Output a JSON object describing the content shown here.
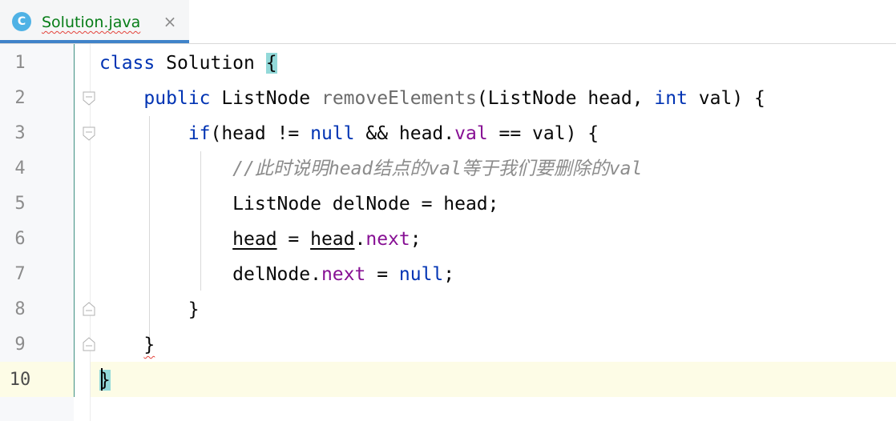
{
  "editor_tab": {
    "icon_letter": "C",
    "title": "Solution.java",
    "close_icon": "×"
  },
  "colors": {
    "keyword": "#0033b3",
    "field": "#871094",
    "comment": "#8c8c8c",
    "brace_highlight": "#93d9d9",
    "current_line": "#fdfce6",
    "tab_underline": "#4083c9"
  },
  "gutter": {
    "line_numbers": [
      "1",
      "2",
      "3",
      "4",
      "5",
      "6",
      "7",
      "8",
      "9",
      "10"
    ],
    "active_line": "10"
  },
  "code": {
    "l1": {
      "kw": "class",
      "name": " Solution ",
      "brace": "{"
    },
    "l2": {
      "indent": "    ",
      "kw1": "public",
      "type": " ListNode ",
      "method": "removeElements",
      "args1": "(ListNode head, ",
      "kw2": "int",
      "args2": " val) {"
    },
    "l3": {
      "indent": "        ",
      "kw1": "if",
      "p1": "(head != ",
      "kw2": "null",
      "p2": " && head.",
      "field": "val",
      "p3": " == val) {"
    },
    "l4": {
      "indent": "            ",
      "comment_parts": [
        "//此时说明",
        "head",
        "结点的",
        "val",
        "等于我们要删除的",
        "val"
      ]
    },
    "l5": {
      "indent": "            ",
      "text": "ListNode delNode = head;"
    },
    "l6": {
      "indent": "            ",
      "var1": "head",
      "mid": " = ",
      "var2": "head",
      "dot": ".",
      "field": "next",
      "end": ";"
    },
    "l7": {
      "indent": "            ",
      "p1": "delNode.",
      "field": "next",
      "p2": " = ",
      "kw": "null",
      "end": ";"
    },
    "l8": {
      "indent": "        ",
      "text": "}"
    },
    "l9": {
      "indent": "    ",
      "text": "}"
    },
    "l10": {
      "brace": "}"
    }
  }
}
